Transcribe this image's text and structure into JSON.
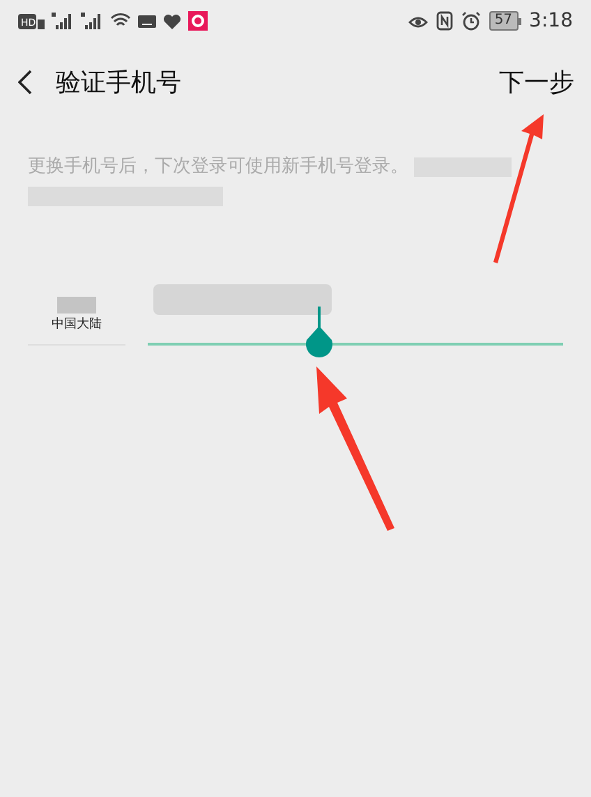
{
  "status_bar": {
    "network_badge": "HD",
    "battery": "57",
    "time": "3:18"
  },
  "header": {
    "title": "验证手机号",
    "action": "下一步"
  },
  "notice": "更换手机号后，下次登录可使用新手机号登录。",
  "phone_form": {
    "region": "中国大陆"
  }
}
